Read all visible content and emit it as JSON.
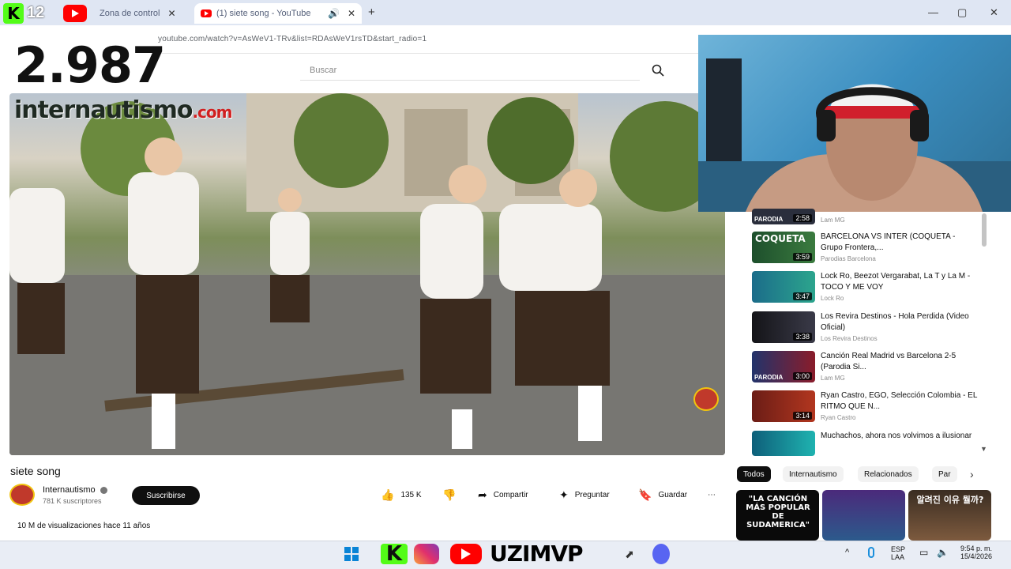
{
  "overlay": {
    "counter": "2.987",
    "kick_logo": "K",
    "kick_count": "12",
    "uzi_text": "UZIMVP"
  },
  "browser": {
    "tabs": [
      {
        "label": "Zona de control",
        "active": false,
        "icon": "youtube-icon"
      },
      {
        "label": "(1) siete song - YouTube",
        "active": true,
        "icon": "youtube-icon"
      }
    ],
    "new_tab": "+",
    "url": "youtube.com/watch?v=AsWeV1-TRv&list=RDAsWeV1rsTD&start_radio=1",
    "win_controls": {
      "minimize": "—",
      "maximize": "▢",
      "close": "✕"
    }
  },
  "youtube": {
    "search_placeholder": "Buscar",
    "video": {
      "watermark": "internautismo",
      "watermark_suffix": ".com",
      "title": "siete song"
    },
    "channel": {
      "name": "Internautismo",
      "subscribers": "781 K suscriptores",
      "subscribe_label": "Suscribirse"
    },
    "actions": {
      "likes": "135 K",
      "share": "Compartir",
      "ask": "Preguntar",
      "save": "Guardar",
      "more": "⋯"
    },
    "meta": "10 M de visualizaciones  hace 11 años",
    "recommendations": [
      {
        "title": "",
        "channel": "Lam MG",
        "duration": "2:58",
        "thumb_text": "PARODIA"
      },
      {
        "title": "BARCELONA VS INTER (COQUETA - Grupo Frontera,...",
        "channel": "Parodias Barcelona",
        "duration": "3:59",
        "thumb_text": "COQUETA"
      },
      {
        "title": "Lock Ro, Beezot Vergarabat, La T y La M - TOCO Y ME VOY",
        "channel": "Lock Ro",
        "duration": "3:47",
        "thumb_text": ""
      },
      {
        "title": "Los Revira Destinos - Hola Perdida (Video Oficial)",
        "channel": "Los Revira Destinos",
        "duration": "3:38",
        "thumb_text": ""
      },
      {
        "title": "Canción Real Madrid vs Barcelona 2-5 (Parodia Si...",
        "channel": "Lam MG",
        "duration": "3:00",
        "thumb_text": "PARODIA"
      },
      {
        "title": "Ryan Castro, EGO, Selección Colombia - EL RITMO QUE N...",
        "channel": "Ryan Castro",
        "duration": "3:14",
        "thumb_text": ""
      },
      {
        "title": "Muchachos, ahora nos volvimos a ilusionar",
        "channel": "",
        "duration": "",
        "thumb_text": ""
      }
    ],
    "chips": [
      "Todos",
      "Internautismo",
      "Relacionados",
      "Par"
    ],
    "shelf": [
      {
        "text": "\"LA CANCIÓN MÁS POPULAR DE SUDAMERICA\""
      },
      {
        "text": ""
      },
      {
        "text": "알려진 이유 뭘까?"
      }
    ]
  },
  "taskbar": {
    "language": "ESP",
    "layout": "LAA",
    "time": "9:54 p. m.",
    "date": "15/4/2026",
    "chevron": "^"
  },
  "colors": {
    "youtube_red": "#ff0000",
    "kick_green": "#53fc18",
    "tab_strip": "#dfe6f3",
    "taskbar": "#e9edf5"
  }
}
